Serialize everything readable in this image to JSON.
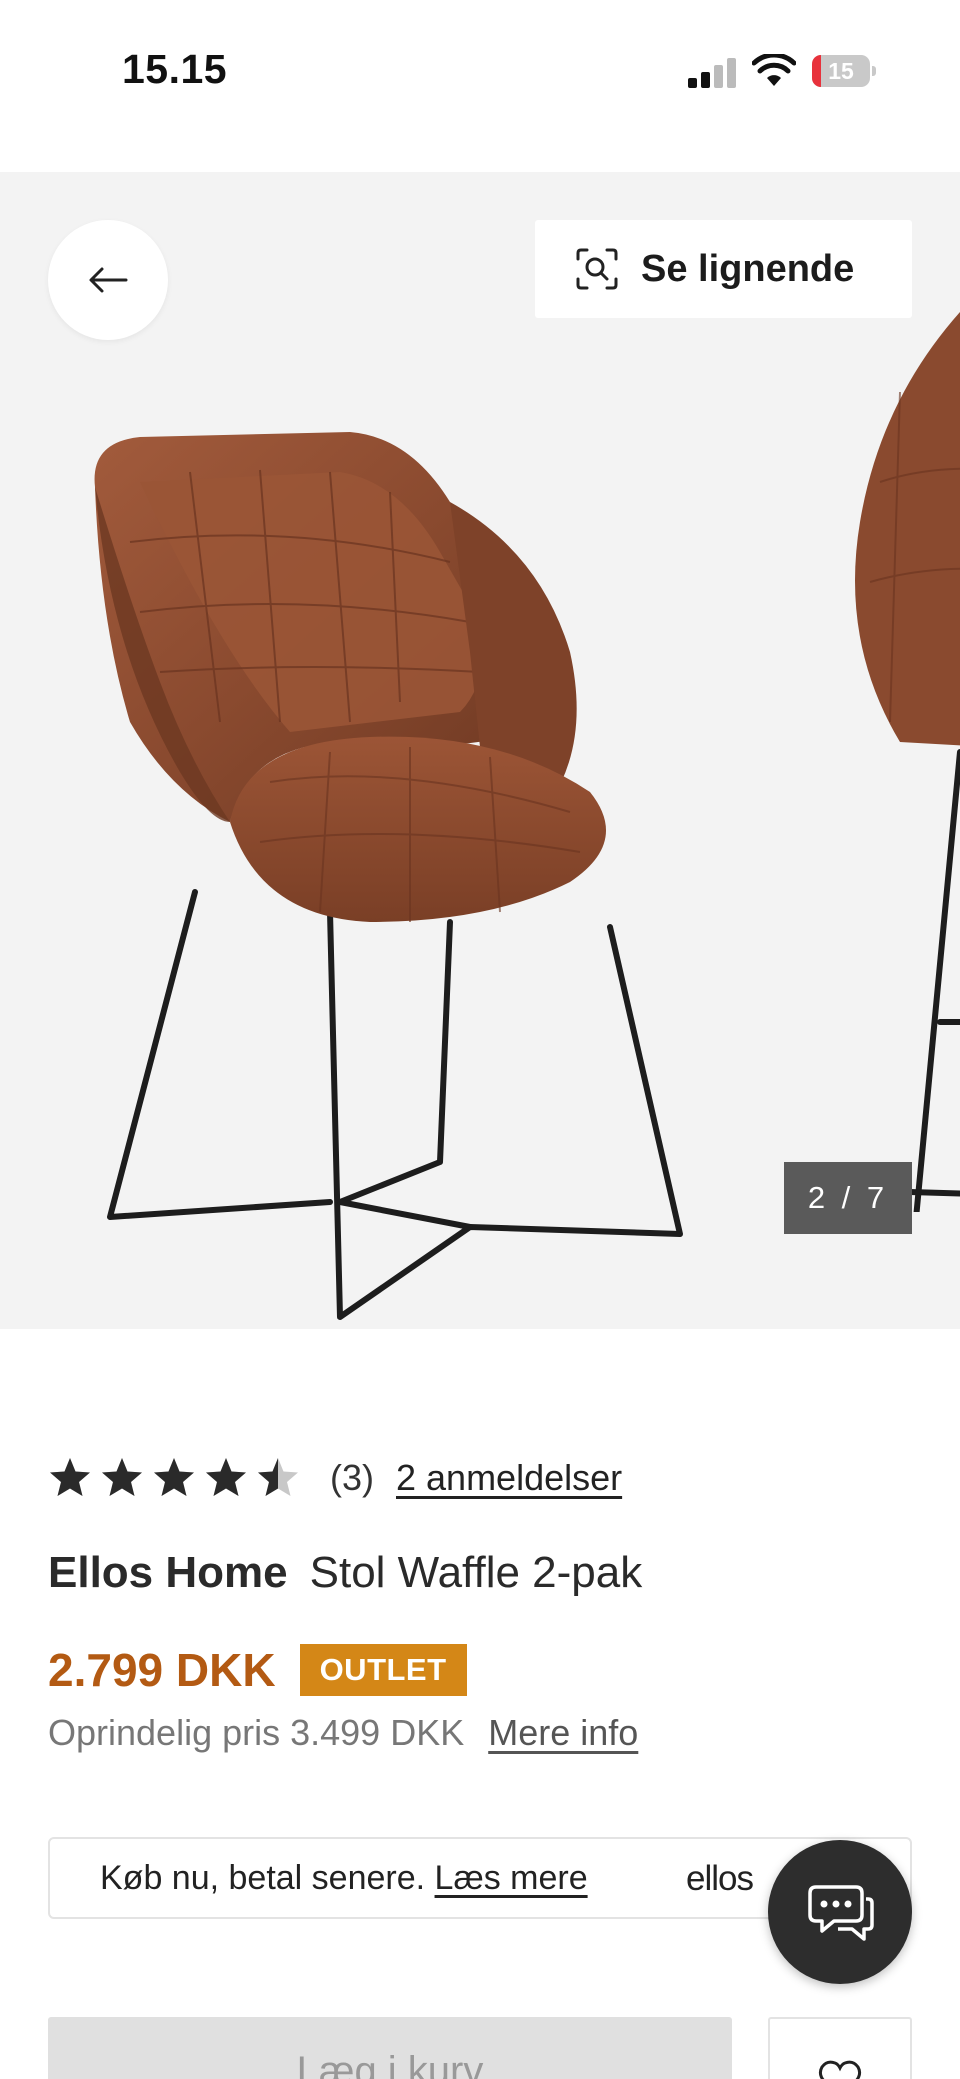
{
  "status_bar": {
    "time": "15.15",
    "battery_level": "15",
    "battery_fraction": 0.15
  },
  "gallery": {
    "similar_label": "Se lignende",
    "counter": "2 / 7",
    "icons": {
      "back": "arrow-left-icon",
      "similar": "visual-search-icon"
    }
  },
  "product": {
    "rating": {
      "value": 4.5,
      "max": 5,
      "count": "(3)",
      "reviews_link": "2 anmeldelser"
    },
    "brand": "Ellos Home",
    "name": "Stol Waffle 2-pak",
    "price": "2.799 DKK",
    "badge": "OUTLET",
    "original_price": "Oprindelig pris 3.499 DKK",
    "more_info": "Mere info"
  },
  "bnpl": {
    "text": "Køb nu, betal senere.",
    "link": "Læs mere",
    "logo": "ellos"
  },
  "actions": {
    "add_label": "Læg i kurv",
    "favorite_icon": "heart-icon",
    "chat_icon": "chat-bubble-icon"
  },
  "colors": {
    "price": "#b35a13",
    "badge": "#d48717",
    "chat_fab": "#2d2d2d",
    "hero_bg": "#f3f3f3"
  }
}
